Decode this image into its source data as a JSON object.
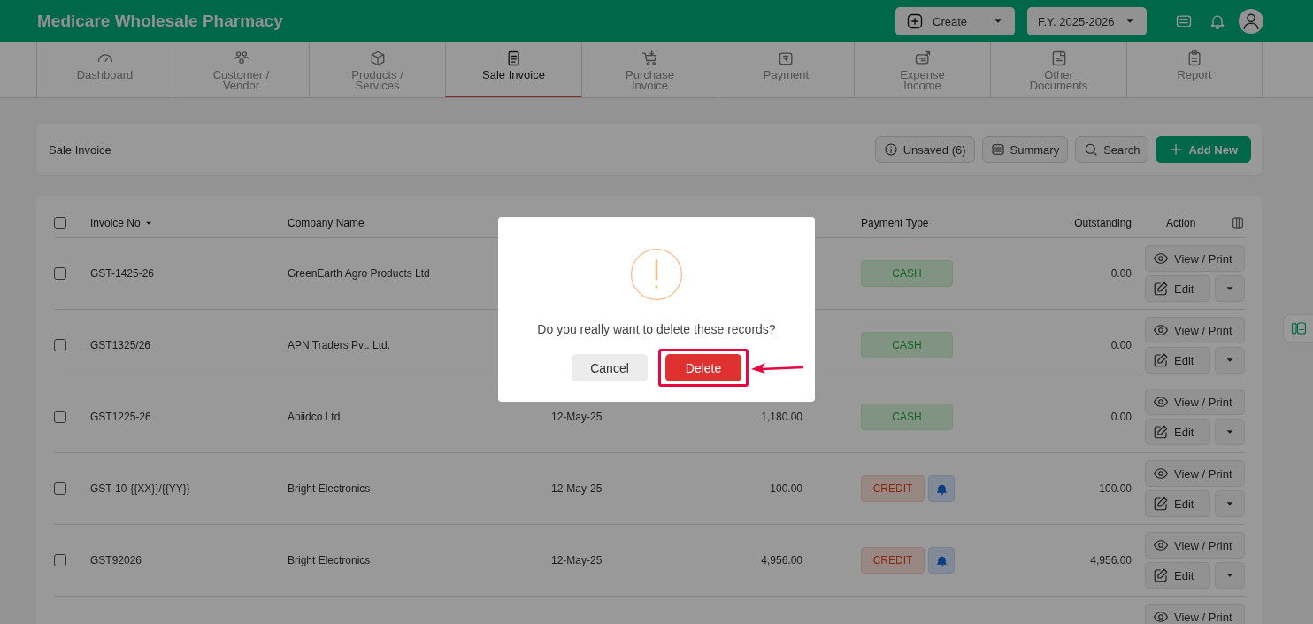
{
  "header": {
    "app_title": "Medicare Wholesale Pharmacy",
    "create_label": "Create",
    "fiscal_year": "F.Y. 2025-2026"
  },
  "nav": {
    "tabs": [
      {
        "label": "Dashboard",
        "selected": false
      },
      {
        "label": "Customer / Vendor",
        "selected": false
      },
      {
        "label": "Products / Services",
        "selected": false
      },
      {
        "label": "Sale Invoice",
        "selected": true
      },
      {
        "label": "Purchase Invoice",
        "selected": false
      },
      {
        "label": "Payment",
        "selected": false
      },
      {
        "label": "Expense Income",
        "selected": false
      },
      {
        "label": "Other Documents",
        "selected": false
      },
      {
        "label": "Report",
        "selected": false
      }
    ]
  },
  "toolbar": {
    "title": "Sale Invoice",
    "buttons": [
      {
        "label": "Unsaved (6)",
        "kind": "outline"
      },
      {
        "label": "Summary",
        "kind": "outline"
      },
      {
        "label": "Search",
        "kind": "outline"
      },
      {
        "label": "Add New",
        "kind": "primary"
      }
    ]
  },
  "table": {
    "select_all_checked": false,
    "columns": [
      {
        "label": "Invoice No",
        "sorted": true
      },
      {
        "label": "Company Name",
        "sorted": false
      },
      {
        "label": "Payment Type",
        "sorted": false
      },
      {
        "label": "Outstanding",
        "sorted": false
      },
      {
        "label": "Action",
        "sorted": false
      }
    ],
    "rows": [
      {
        "checked": false,
        "invoice_no": "GST-1425-26",
        "company": "GreenEarth Agro Products Ltd",
        "payment_type": "CASH",
        "kind": "cash",
        "outstanding": "0.00",
        "view_label": "View / Print",
        "edit_label": "Edit"
      },
      {
        "checked": false,
        "invoice_no": "GST1325/26",
        "company": "APN Traders Pvt. Ltd.",
        "payment_type": "CASH",
        "kind": "cash",
        "outstanding": "0.00",
        "view_label": "View / Print",
        "edit_label": "Edit"
      },
      {
        "checked": false,
        "invoice_no": "GST1225-26",
        "company": "Aniidco Ltd",
        "date": "12-May-25",
        "total": "1,180.00",
        "payment_type": "CASH",
        "kind": "cash",
        "outstanding": "0.00",
        "view_label": "View / Print",
        "edit_label": "Edit"
      },
      {
        "checked": false,
        "invoice_no": "GST-10-{{XX}}/{{YY}}",
        "company": "Bright Electronics",
        "date": "12-May-25",
        "total": "100.00",
        "payment_type": "CREDIT",
        "kind": "credit",
        "outstanding": "100.00",
        "view_label": "View / Print",
        "edit_label": "Edit"
      },
      {
        "checked": false,
        "invoice_no": "GST92026",
        "company": "Bright Electronics",
        "date": "12-May-25",
        "total": "4,956.00",
        "payment_type": "CREDIT",
        "kind": "credit",
        "outstanding": "4,956.00",
        "view_label": "View / Print",
        "edit_label": "Edit"
      },
      {
        "view_label": "View / Print"
      }
    ]
  },
  "dialog": {
    "message": "Do you really want to delete these records?",
    "buttons": [
      {
        "label": "Cancel",
        "kind": "secondary",
        "highlighted": false
      },
      {
        "label": "Delete",
        "kind": "danger",
        "highlighted": true
      }
    ]
  }
}
